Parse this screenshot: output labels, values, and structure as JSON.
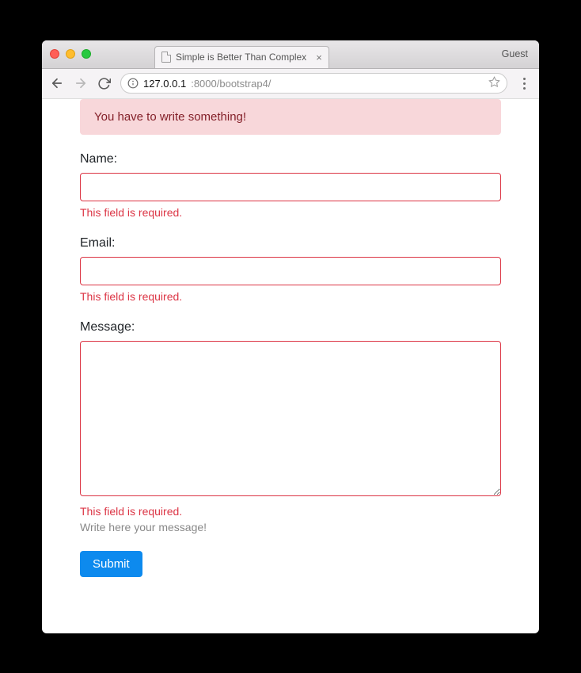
{
  "window": {
    "guest_label": "Guest"
  },
  "tab": {
    "title": "Simple is Better Than Complex"
  },
  "addressbar": {
    "host": "127.0.0.1",
    "rest": ":8000/bootstrap4/"
  },
  "alert": {
    "text": "You have to write something!"
  },
  "form": {
    "name": {
      "label": "Name:",
      "value": "",
      "error": "This field is required."
    },
    "email": {
      "label": "Email:",
      "value": "",
      "error": "This field is required."
    },
    "message": {
      "label": "Message:",
      "value": "",
      "error": "This field is required.",
      "help": "Write here your message!"
    },
    "submit_label": "Submit"
  }
}
